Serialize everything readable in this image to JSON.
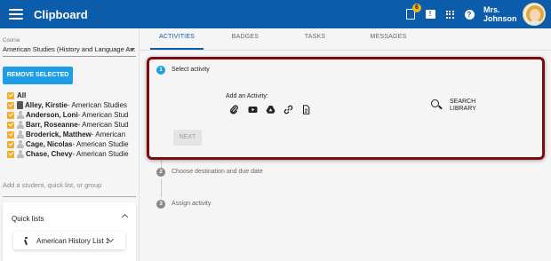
{
  "app": {
    "title": "Clipboard",
    "notification_count": "6",
    "user_name": "Mrs. Johnson"
  },
  "sidebar": {
    "course_label": "Course",
    "course_value": "American Studies (History and Language Ar...",
    "remove_selected": "REMOVE SELECTED",
    "students": [
      {
        "name": "All",
        "course": ""
      },
      {
        "name": "Alley, Kirstie",
        "course": " - American Studies"
      },
      {
        "name": "Anderson, Loni",
        "course": " - American Stud"
      },
      {
        "name": "Barr, Roseanne",
        "course": " - American Stud"
      },
      {
        "name": "Broderick, Matthew",
        "course": " - American"
      },
      {
        "name": "Cage, Nicolas",
        "course": " - American Studie"
      },
      {
        "name": "Chase, Chevy",
        "course": " - American Studie"
      }
    ],
    "add_student_placeholder": "Add a student, quick list, or group",
    "quick_lists_title": "Quick lists",
    "quick_list_item": "American History List 1"
  },
  "tabs": [
    "ACTIVITIES",
    "BADGES",
    "TASKS",
    "MESSAGES"
  ],
  "steps": [
    {
      "num": "1",
      "label": "Select activity"
    },
    {
      "num": "2",
      "label": "Choose destination and due date"
    },
    {
      "num": "3",
      "label": "Assign activity"
    }
  ],
  "activity": {
    "add_label": "Add an Activity:",
    "icons": [
      "paperclip-icon",
      "youtube-icon",
      "google-drive-icon",
      "link-icon",
      "document-icon"
    ],
    "search_library": "SEARCH LIBRARY",
    "next_label": "NEXT"
  },
  "colors": {
    "appbar": "#0b5cab",
    "accent": "#1e9ee6",
    "checkbox": "#f3ad2a",
    "highlight": "#7b0d12"
  }
}
